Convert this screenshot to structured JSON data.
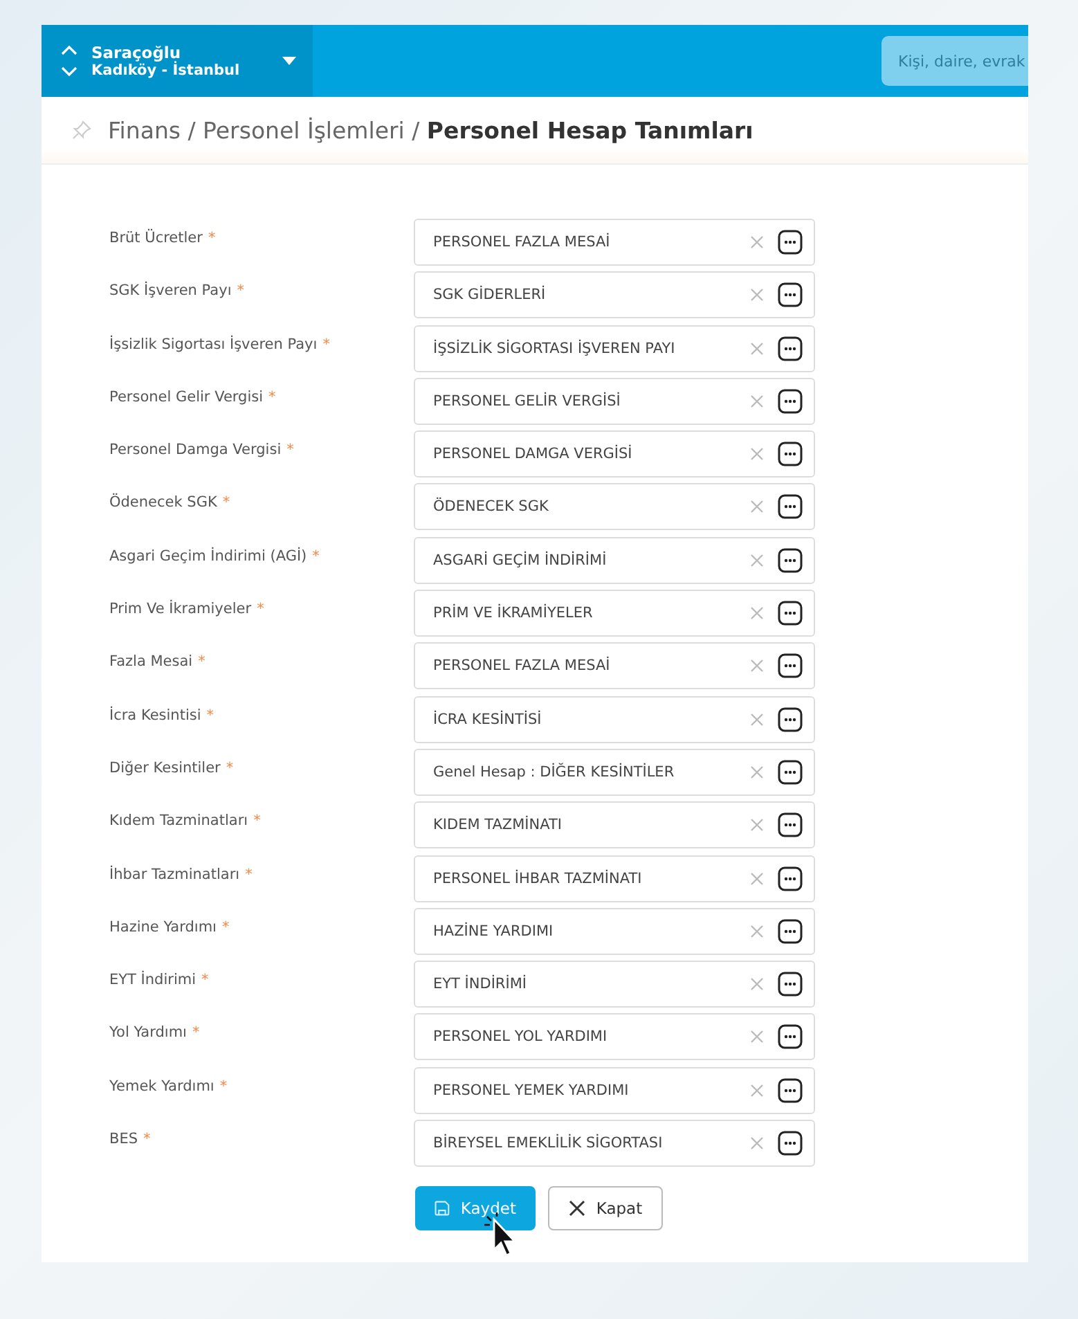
{
  "site": {
    "name": "Saraçoğlu",
    "location": "Kadıköy - İstanbul"
  },
  "search": {
    "placeholder": "Kişi, daire, evrak"
  },
  "breadcrumb": "Finans / Personel İşlemleri / **Personel Hesap Tanımları**",
  "fields": [
    {
      "label": "Brüt Ücretler",
      "required_mark": "*",
      "value": "PERSONEL FAZLA MESAİ"
    },
    {
      "label": "SGK İşveren Payı",
      "required_mark": "*",
      "value": "SGK GİDERLERİ"
    },
    {
      "label": "İşsizlik Sigortası İşveren Payı",
      "required_mark": "*",
      "value": "İŞSİZLİK SİGORTASI İŞVEREN PAYI"
    },
    {
      "label": "Personel Gelir Vergisi",
      "required_mark": "*",
      "value": "PERSONEL GELİR VERGİSİ"
    },
    {
      "label": "Personel Damga Vergisi",
      "required_mark": "*",
      "value": "PERSONEL DAMGA VERGİSİ"
    },
    {
      "label": "Ödenecek SGK",
      "required_mark": "*",
      "value": "ÖDENECEK SGK"
    },
    {
      "label": "Asgari Geçim İndirimi (AGİ)",
      "required_mark": "*",
      "value": "ASGARİ GEÇİM İNDİRİMİ"
    },
    {
      "label": "Prim Ve İkramiyeler",
      "required_mark": "*",
      "value": "PRİM VE İKRAMİYELER"
    },
    {
      "label": "Fazla Mesai",
      "required_mark": "*",
      "value": "PERSONEL FAZLA MESAİ"
    },
    {
      "label": "İcra Kesintisi",
      "required_mark": "*",
      "value": "İCRA KESİNTİSİ"
    },
    {
      "label": "Diğer Kesintiler",
      "required_mark": "*",
      "value": "Genel Hesap : DİĞER KESİNTİLER"
    },
    {
      "label": "Kıdem Tazminatları",
      "required_mark": "*",
      "value": "KIDEM TAZMİNATI"
    },
    {
      "label": "İhbar Tazminatları",
      "required_mark": "*",
      "value": "PERSONEL İHBAR TAZMİNATI"
    },
    {
      "label": "Hazine Yardımı",
      "required_mark": "*",
      "value": "HAZİNE YARDIMI"
    },
    {
      "label": "EYT İndirimi",
      "required_mark": "*",
      "value": "EYT İNDİRİMİ"
    },
    {
      "label": "Yol Yardımı",
      "required_mark": "*",
      "value": "PERSONEL YOL YARDIMI"
    },
    {
      "label": "Yemek Yardımı",
      "required_mark": "*",
      "value": "PERSONEL YEMEK YARDIMI"
    },
    {
      "label": "BES",
      "required_mark": "*",
      "value": "BİREYSEL EMEKLİLİK SİGORTASI"
    }
  ],
  "buttons": [
    {
      "kind": "save",
      "label": "Kaydet"
    },
    {
      "kind": "close",
      "label": "Kapat"
    }
  ]
}
